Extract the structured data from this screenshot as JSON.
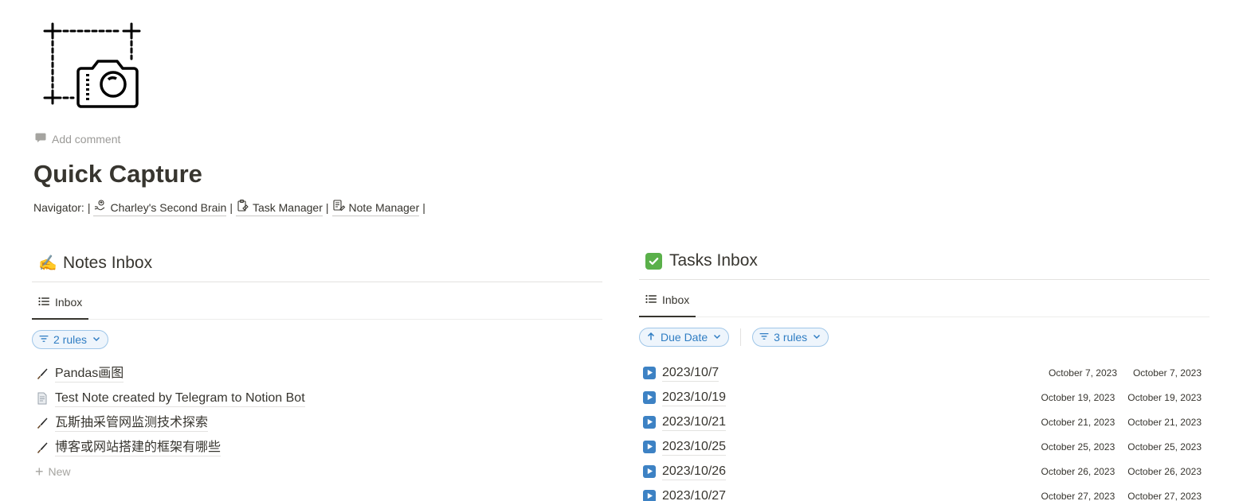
{
  "page": {
    "title": "Quick Capture",
    "add_comment": "Add comment",
    "icon": "camera-capture-icon"
  },
  "navigator": {
    "label": "Navigator:",
    "separator": "|",
    "links": [
      {
        "label": "Charley's Second Brain",
        "icon": "brain-hand-icon"
      },
      {
        "label": "Task Manager",
        "icon": "clipboard-icon"
      },
      {
        "label": "Note Manager",
        "icon": "notes-icon"
      }
    ]
  },
  "notes_inbox": {
    "emoji": "✍️",
    "title": "Notes Inbox",
    "tab": "Inbox",
    "filter": "2 rules",
    "items": [
      {
        "icon": "pen-icon",
        "name": "Pandas画图"
      },
      {
        "icon": "document-icon",
        "name": "Test Note created by Telegram to Notion Bot"
      },
      {
        "icon": "pen-icon",
        "name": "瓦斯抽采管网监测技术探索"
      },
      {
        "icon": "pen-icon",
        "name": "博客或网站搭建的框架有哪些"
      }
    ],
    "new_label": "New"
  },
  "tasks_inbox": {
    "emoji": "✅",
    "title": "Tasks Inbox",
    "tab": "Inbox",
    "sort": "Due Date",
    "filter": "3 rules",
    "accent": "#2f7dc3",
    "items": [
      {
        "name": "2023/10/7",
        "date1": "October 7, 2023",
        "date2": "October 7, 2023"
      },
      {
        "name": "2023/10/19",
        "date1": "October 19, 2023",
        "date2": "October 19, 2023"
      },
      {
        "name": "2023/10/21",
        "date1": "October 21, 2023",
        "date2": "October 21, 2023"
      },
      {
        "name": "2023/10/25",
        "date1": "October 25, 2023",
        "date2": "October 25, 2023"
      },
      {
        "name": "2023/10/26",
        "date1": "October 26, 2023",
        "date2": "October 26, 2023"
      },
      {
        "name": "2023/10/27",
        "date1": "October 27, 2023",
        "date2": "October 27, 2023"
      }
    ]
  }
}
